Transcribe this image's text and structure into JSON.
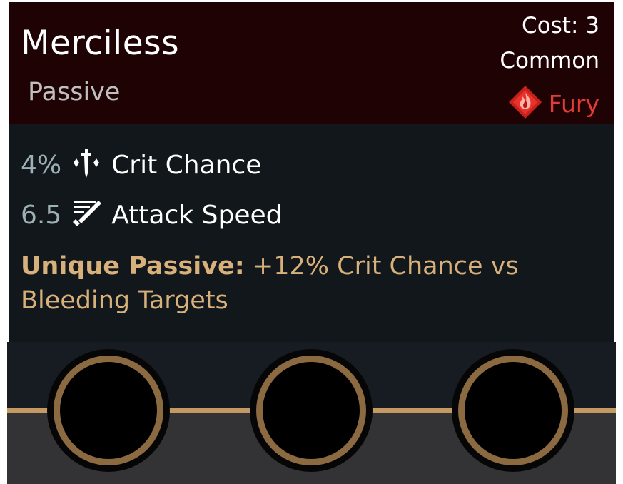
{
  "card": {
    "title": "Merciless",
    "subtype": "Passive",
    "cost": "Cost: 3",
    "rarity": "Common",
    "element": {
      "label": "Fury",
      "icon": "fury-flame-icon",
      "color": "#e33b36"
    },
    "stats": [
      {
        "value": "4%",
        "icon": "crit-chance-icon",
        "label": "Crit Chance"
      },
      {
        "value": "6.5",
        "icon": "attack-speed-icon",
        "label": "Attack Speed"
      }
    ],
    "unique": {
      "label": "Unique Passive:",
      "text": " +12% Crit Chance vs Bleeding Targets"
    }
  },
  "sockets": [
    {
      "name": "socket-1",
      "state": "empty"
    },
    {
      "name": "socket-2",
      "state": "empty"
    },
    {
      "name": "socket-3",
      "state": "empty"
    }
  ],
  "colors": {
    "header_bg": "#1f0204",
    "body_bg": "#11171b",
    "gold_accent": "#c49a62",
    "unique_text": "#d8b07b",
    "socket_ring": "#8b6a41"
  }
}
